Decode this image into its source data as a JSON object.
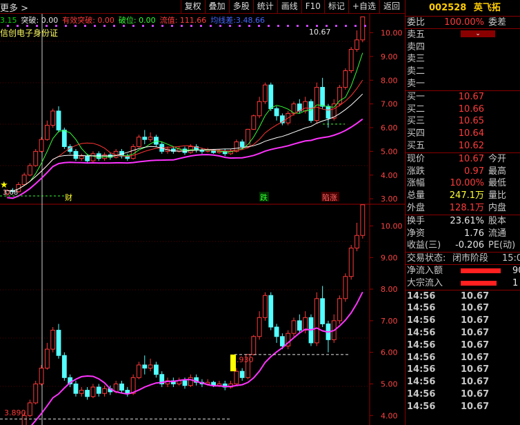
{
  "toolbar": {
    "more_label": "更多 >",
    "buttons": [
      "复权",
      "叠加",
      "多股",
      "统计",
      "画线",
      "F10",
      "标记",
      "+自选",
      "返回"
    ]
  },
  "legend": {
    "indicators": [
      {
        "label": "3.15",
        "color": "#00dd00"
      },
      {
        "label": "突破: 0.00",
        "color": "#e8e8e8"
      },
      {
        "label": "有效突破: 0.00",
        "color": "#ff3b3b"
      },
      {
        "label": "破位: 0.00",
        "color": "#33ff33"
      },
      {
        "label": "流值: 111.66",
        "color": "#ff3b3b"
      },
      {
        "label": "均线差:3.48.66",
        "color": "#4466ff"
      }
    ],
    "subtitle": "信创电子身份证"
  },
  "markers": {
    "price_top_label": "10.67",
    "low_label": "3.08",
    "cai_label": "财",
    "die_label": "跌",
    "zhang_label": "陷涨",
    "mid_label": "5.930",
    "bottom_label": "3.890",
    "star_label": "★"
  },
  "axes": {
    "upper": [
      "10.00",
      "9.00",
      "8.00",
      "7.00",
      "6.00",
      "5.00",
      "4.00",
      "3.00"
    ],
    "lower": [
      "10.00",
      "9.00",
      "8.00",
      "7.00",
      "6.00",
      "5.00",
      "4.00"
    ]
  },
  "chart_data": {
    "type": "candlestick",
    "y_range_upper": [
      2.8,
      10.8
    ],
    "y_range_lower": [
      3.7,
      10.6
    ],
    "candles": [
      {
        "o": 3.2,
        "c": 3.35,
        "h": 3.4,
        "l": 3.1
      },
      {
        "o": 3.35,
        "c": 3.3,
        "h": 3.45,
        "l": 3.2
      },
      {
        "o": 3.3,
        "c": 3.6,
        "h": 3.7,
        "l": 3.25
      },
      {
        "o": 3.6,
        "c": 4.0,
        "h": 4.1,
        "l": 3.55
      },
      {
        "o": 4.0,
        "c": 4.4,
        "h": 4.5,
        "l": 3.95
      },
      {
        "o": 4.4,
        "c": 5.0,
        "h": 5.1,
        "l": 4.35
      },
      {
        "o": 5.0,
        "c": 5.5,
        "h": 5.6,
        "l": 4.95
      },
      {
        "o": 5.5,
        "c": 6.1,
        "h": 6.3,
        "l": 5.45
      },
      {
        "o": 6.1,
        "c": 6.7,
        "h": 6.8,
        "l": 6.0
      },
      {
        "o": 6.7,
        "c": 5.9,
        "h": 6.9,
        "l": 5.8
      },
      {
        "o": 5.9,
        "c": 5.2,
        "h": 6.0,
        "l": 5.1
      },
      {
        "o": 5.2,
        "c": 5.0,
        "h": 5.3,
        "l": 4.9
      },
      {
        "o": 5.0,
        "c": 4.7,
        "h": 5.1,
        "l": 4.6
      },
      {
        "o": 4.7,
        "c": 4.8,
        "h": 4.9,
        "l": 4.6
      },
      {
        "o": 4.8,
        "c": 4.6,
        "h": 4.9,
        "l": 4.5
      },
      {
        "o": 4.6,
        "c": 4.9,
        "h": 5.0,
        "l": 4.55
      },
      {
        "o": 4.9,
        "c": 4.7,
        "h": 5.0,
        "l": 4.6
      },
      {
        "o": 4.7,
        "c": 4.85,
        "h": 4.95,
        "l": 4.6
      },
      {
        "o": 4.85,
        "c": 4.75,
        "h": 4.95,
        "l": 4.65
      },
      {
        "o": 4.75,
        "c": 5.0,
        "h": 5.1,
        "l": 4.7
      },
      {
        "o": 5.0,
        "c": 4.8,
        "h": 5.1,
        "l": 4.7
      },
      {
        "o": 4.8,
        "c": 4.7,
        "h": 4.9,
        "l": 4.6
      },
      {
        "o": 4.7,
        "c": 5.2,
        "h": 5.3,
        "l": 4.65
      },
      {
        "o": 5.2,
        "c": 5.6,
        "h": 5.7,
        "l": 5.15
      },
      {
        "o": 5.6,
        "c": 5.5,
        "h": 5.9,
        "l": 5.3
      },
      {
        "o": 5.5,
        "c": 5.6,
        "h": 5.8,
        "l": 5.4
      },
      {
        "o": 5.6,
        "c": 5.3,
        "h": 5.7,
        "l": 5.2
      },
      {
        "o": 5.3,
        "c": 5.0,
        "h": 5.4,
        "l": 4.9
      },
      {
        "o": 5.0,
        "c": 5.1,
        "h": 5.2,
        "l": 4.9
      },
      {
        "o": 5.1,
        "c": 5.0,
        "h": 5.2,
        "l": 4.9
      },
      {
        "o": 5.0,
        "c": 5.1,
        "h": 5.2,
        "l": 4.95
      },
      {
        "o": 5.1,
        "c": 4.95,
        "h": 5.2,
        "l": 4.85
      },
      {
        "o": 4.95,
        "c": 5.2,
        "h": 5.3,
        "l": 4.9
      },
      {
        "o": 5.2,
        "c": 5.05,
        "h": 5.3,
        "l": 4.95
      },
      {
        "o": 5.05,
        "c": 5.0,
        "h": 5.15,
        "l": 4.9
      },
      {
        "o": 5.0,
        "c": 5.05,
        "h": 5.15,
        "l": 4.95
      },
      {
        "o": 5.05,
        "c": 4.95,
        "h": 5.1,
        "l": 4.9
      },
      {
        "o": 4.95,
        "c": 5.0,
        "h": 5.1,
        "l": 4.9
      },
      {
        "o": 5.0,
        "c": 4.9,
        "h": 5.1,
        "l": 4.8
      },
      {
        "o": 4.9,
        "c": 5.0,
        "h": 5.1,
        "l": 4.85
      },
      {
        "o": 5.0,
        "c": 5.4,
        "h": 5.5,
        "l": 4.95
      },
      {
        "o": 5.4,
        "c": 5.2,
        "h": 5.5,
        "l": 5.1
      },
      {
        "o": 5.2,
        "c": 5.93,
        "h": 5.95,
        "l": 5.15
      },
      {
        "o": 5.93,
        "c": 6.5,
        "h": 6.55,
        "l": 5.9
      },
      {
        "o": 6.5,
        "c": 7.1,
        "h": 7.3,
        "l": 6.4
      },
      {
        "o": 7.1,
        "c": 7.8,
        "h": 7.9,
        "l": 7.0
      },
      {
        "o": 7.8,
        "c": 6.8,
        "h": 7.9,
        "l": 6.7
      },
      {
        "o": 6.8,
        "c": 6.5,
        "h": 6.9,
        "l": 6.3
      },
      {
        "o": 6.5,
        "c": 6.2,
        "h": 6.6,
        "l": 6.1
      },
      {
        "o": 6.2,
        "c": 6.6,
        "h": 6.7,
        "l": 6.1
      },
      {
        "o": 6.6,
        "c": 7.0,
        "h": 7.1,
        "l": 6.5
      },
      {
        "o": 7.0,
        "c": 6.7,
        "h": 7.2,
        "l": 6.6
      },
      {
        "o": 6.7,
        "c": 7.1,
        "h": 7.3,
        "l": 6.6
      },
      {
        "o": 7.1,
        "c": 6.3,
        "h": 7.2,
        "l": 6.2
      },
      {
        "o": 6.3,
        "c": 7.7,
        "h": 7.9,
        "l": 6.2
      },
      {
        "o": 7.7,
        "c": 6.9,
        "h": 8.1,
        "l": 6.8
      },
      {
        "o": 6.9,
        "c": 6.4,
        "h": 7.0,
        "l": 6.0
      },
      {
        "o": 6.4,
        "c": 7.0,
        "h": 7.2,
        "l": 6.3
      },
      {
        "o": 7.0,
        "c": 7.7,
        "h": 7.8,
        "l": 6.9
      },
      {
        "o": 7.7,
        "c": 8.4,
        "h": 8.5,
        "l": 7.6
      },
      {
        "o": 8.4,
        "c": 9.3,
        "h": 9.4,
        "l": 8.3
      },
      {
        "o": 9.3,
        "c": 9.7,
        "h": 10.1,
        "l": 9.2
      },
      {
        "o": 9.7,
        "c": 10.67,
        "h": 10.67,
        "l": 9.6
      }
    ]
  },
  "quote": {
    "code": "002528",
    "name": "英飞拓",
    "weibi_label": "委比",
    "weibi_value": "100.00%",
    "weicha_label": "委差",
    "sell": [
      {
        "label": "卖五",
        "price": "",
        "vol": ""
      },
      {
        "label": "卖四",
        "price": "",
        "vol": ""
      },
      {
        "label": "卖三",
        "price": "",
        "vol": ""
      },
      {
        "label": "卖二",
        "price": "",
        "vol": ""
      },
      {
        "label": "卖一",
        "price": "",
        "vol": ""
      }
    ],
    "buy": [
      {
        "label": "买一",
        "price": "10.67"
      },
      {
        "label": "买二",
        "price": "10.66"
      },
      {
        "label": "买三",
        "price": "10.65"
      },
      {
        "label": "买四",
        "price": "10.64"
      },
      {
        "label": "买五",
        "price": "10.62"
      }
    ],
    "stats": [
      {
        "label": "现价",
        "value": "10.67",
        "label2": "今开",
        "color": "#ff3b3b"
      },
      {
        "label": "涨跌",
        "value": "0.97",
        "label2": "最高",
        "color": "#ff3b3b"
      },
      {
        "label": "涨幅",
        "value": "10.00%",
        "label2": "最低",
        "color": "#ff3b3b"
      },
      {
        "label": "总量",
        "value": "247.1万",
        "label2": "量比",
        "color": "#ffff33"
      },
      {
        "label": "外盘",
        "value": "128.1万",
        "label2": "内盘",
        "color": "#ff3b3b"
      }
    ],
    "stats2": [
      {
        "label": "换手",
        "value": "23.61%",
        "label2": "股本",
        "color": "#e8e8e8"
      },
      {
        "label": "净资",
        "value": "1.76",
        "label2": "流通",
        "color": "#e8e8e8"
      },
      {
        "label": "收益(三)",
        "value": "-0.206",
        "label2": "PE(动)",
        "color": "#e8e8e8"
      }
    ],
    "trade_state_label": "交易状态:",
    "trade_state_value": "闭市阶段",
    "trade_state_time": "15:0",
    "flow": [
      {
        "label": "净流入额",
        "value": "90"
      },
      {
        "label": "大宗流入",
        "value": "1"
      }
    ],
    "ticks": [
      {
        "time": "14:56",
        "price": "10.67"
      },
      {
        "time": "14:56",
        "price": "10.67"
      },
      {
        "time": "14:56",
        "price": "10.67"
      },
      {
        "time": "14:56",
        "price": "10.67"
      },
      {
        "time": "14:56",
        "price": "10.67"
      },
      {
        "time": "14:56",
        "price": "10.67"
      },
      {
        "time": "14:56",
        "price": "10.67"
      },
      {
        "time": "14:56",
        "price": "10.67"
      },
      {
        "time": "14:56",
        "price": "10.67"
      },
      {
        "time": "14:56",
        "price": "10.67"
      }
    ]
  }
}
